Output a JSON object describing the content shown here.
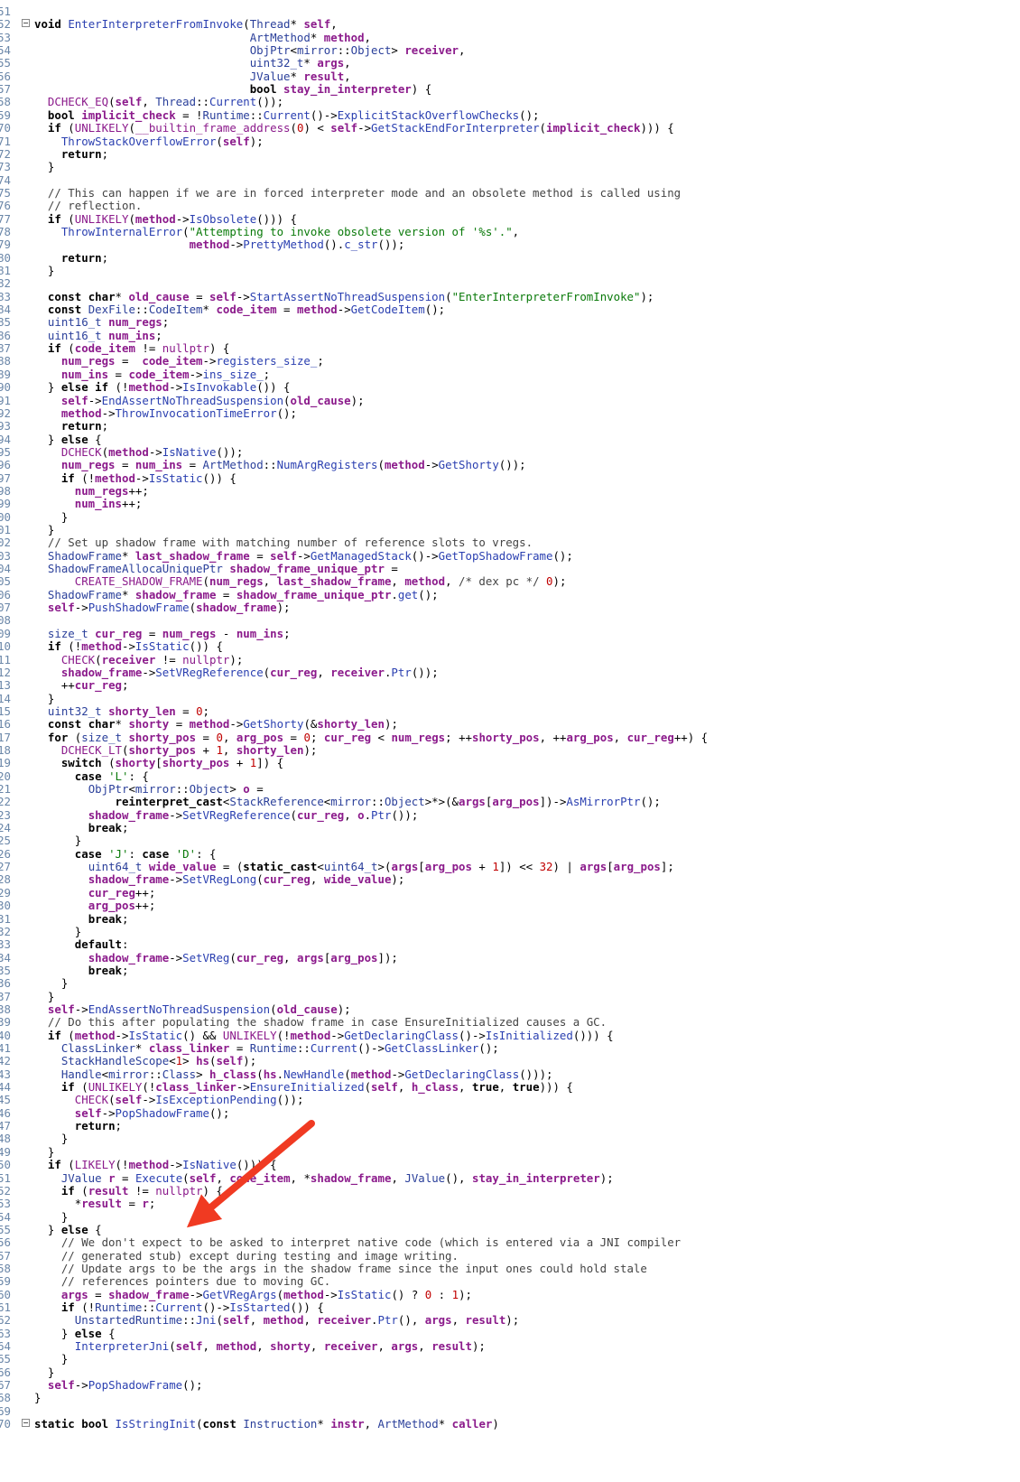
{
  "editor": {
    "lines": [
      {
        "n": "51",
        "t": ""
      },
      {
        "n": "52",
        "t": "void EnterInterpreterFromInvoke(Thread* self,",
        "fold": true
      },
      {
        "n": "53",
        "t": "                                ArtMethod* method,"
      },
      {
        "n": "54",
        "t": "                                ObjPtr<mirror::Object> receiver,"
      },
      {
        "n": "55",
        "t": "                                uint32_t* args,"
      },
      {
        "n": "56",
        "t": "                                JValue* result,"
      },
      {
        "n": "57",
        "t": "                                bool stay_in_interpreter) {"
      },
      {
        "n": "58",
        "t": "  DCHECK_EQ(self, Thread::Current());"
      },
      {
        "n": "59",
        "t": "  bool implicit_check = !Runtime::Current()->ExplicitStackOverflowChecks();"
      },
      {
        "n": "70",
        "t": "  if (UNLIKELY(__builtin_frame_address(0) < self->GetStackEndForInterpreter(implicit_check))) {"
      },
      {
        "n": "71",
        "t": "    ThrowStackOverflowError(self);"
      },
      {
        "n": "72",
        "t": "    return;"
      },
      {
        "n": "73",
        "t": "  }"
      },
      {
        "n": "74",
        "t": ""
      },
      {
        "n": "75",
        "t": "  // This can happen if we are in forced interpreter mode and an obsolete method is called using"
      },
      {
        "n": "76",
        "t": "  // reflection."
      },
      {
        "n": "77",
        "t": "  if (UNLIKELY(method->IsObsolete())) {"
      },
      {
        "n": "78",
        "t": "    ThrowInternalError(\"Attempting to invoke obsolete version of '%s'.\","
      },
      {
        "n": "79",
        "t": "                       method->PrettyMethod().c_str());"
      },
      {
        "n": "80",
        "t": "    return;"
      },
      {
        "n": "81",
        "t": "  }"
      },
      {
        "n": "82",
        "t": ""
      },
      {
        "n": "83",
        "t": "  const char* old_cause = self->StartAssertNoThreadSuspension(\"EnterInterpreterFromInvoke\");"
      },
      {
        "n": "84",
        "t": "  const DexFile::CodeItem* code_item = method->GetCodeItem();"
      },
      {
        "n": "85",
        "t": "  uint16_t num_regs;"
      },
      {
        "n": "86",
        "t": "  uint16_t num_ins;"
      },
      {
        "n": "87",
        "t": "  if (code_item != nullptr) {"
      },
      {
        "n": "88",
        "t": "    num_regs =  code_item->registers_size_;"
      },
      {
        "n": "89",
        "t": "    num_ins = code_item->ins_size_;"
      },
      {
        "n": "90",
        "t": "  } else if (!method->IsInvokable()) {"
      },
      {
        "n": "91",
        "t": "    self->EndAssertNoThreadSuspension(old_cause);"
      },
      {
        "n": "92",
        "t": "    method->ThrowInvocationTimeError();"
      },
      {
        "n": "93",
        "t": "    return;"
      },
      {
        "n": "94",
        "t": "  } else {"
      },
      {
        "n": "95",
        "t": "    DCHECK(method->IsNative());"
      },
      {
        "n": "96",
        "t": "    num_regs = num_ins = ArtMethod::NumArgRegisters(method->GetShorty());"
      },
      {
        "n": "97",
        "t": "    if (!method->IsStatic()) {"
      },
      {
        "n": "98",
        "t": "      num_regs++;"
      },
      {
        "n": "99",
        "t": "      num_ins++;"
      },
      {
        "n": "00",
        "t": "    }"
      },
      {
        "n": "01",
        "t": "  }"
      },
      {
        "n": "02",
        "t": "  // Set up shadow frame with matching number of reference slots to vregs."
      },
      {
        "n": "03",
        "t": "  ShadowFrame* last_shadow_frame = self->GetManagedStack()->GetTopShadowFrame();"
      },
      {
        "n": "04",
        "t": "  ShadowFrameAllocaUniquePtr shadow_frame_unique_ptr ="
      },
      {
        "n": "05",
        "t": "      CREATE_SHADOW_FRAME(num_regs, last_shadow_frame, method, /* dex pc */ 0);"
      },
      {
        "n": "06",
        "t": "  ShadowFrame* shadow_frame = shadow_frame_unique_ptr.get();"
      },
      {
        "n": "07",
        "t": "  self->PushShadowFrame(shadow_frame);"
      },
      {
        "n": "08",
        "t": ""
      },
      {
        "n": "09",
        "t": "  size_t cur_reg = num_regs - num_ins;"
      },
      {
        "n": "10",
        "t": "  if (!method->IsStatic()) {"
      },
      {
        "n": "11",
        "t": "    CHECK(receiver != nullptr);"
      },
      {
        "n": "12",
        "t": "    shadow_frame->SetVRegReference(cur_reg, receiver.Ptr());"
      },
      {
        "n": "13",
        "t": "    ++cur_reg;"
      },
      {
        "n": "14",
        "t": "  }"
      },
      {
        "n": "15",
        "t": "  uint32_t shorty_len = 0;"
      },
      {
        "n": "16",
        "t": "  const char* shorty = method->GetShorty(&shorty_len);"
      },
      {
        "n": "17",
        "t": "  for (size_t shorty_pos = 0, arg_pos = 0; cur_reg < num_regs; ++shorty_pos, ++arg_pos, cur_reg++) {"
      },
      {
        "n": "18",
        "t": "    DCHECK_LT(shorty_pos + 1, shorty_len);"
      },
      {
        "n": "19",
        "t": "    switch (shorty[shorty_pos + 1]) {"
      },
      {
        "n": "20",
        "t": "      case 'L': {"
      },
      {
        "n": "21",
        "t": "        ObjPtr<mirror::Object> o ="
      },
      {
        "n": "22",
        "t": "            reinterpret_cast<StackReference<mirror::Object>*>(&args[arg_pos])->AsMirrorPtr();"
      },
      {
        "n": "23",
        "t": "        shadow_frame->SetVRegReference(cur_reg, o.Ptr());"
      },
      {
        "n": "24",
        "t": "        break;"
      },
      {
        "n": "25",
        "t": "      }"
      },
      {
        "n": "26",
        "t": "      case 'J': case 'D': {"
      },
      {
        "n": "27",
        "t": "        uint64_t wide_value = (static_cast<uint64_t>(args[arg_pos + 1]) << 32) | args[arg_pos];"
      },
      {
        "n": "28",
        "t": "        shadow_frame->SetVRegLong(cur_reg, wide_value);"
      },
      {
        "n": "29",
        "t": "        cur_reg++;"
      },
      {
        "n": "30",
        "t": "        arg_pos++;"
      },
      {
        "n": "31",
        "t": "        break;"
      },
      {
        "n": "32",
        "t": "      }"
      },
      {
        "n": "33",
        "t": "      default:"
      },
      {
        "n": "34",
        "t": "        shadow_frame->SetVReg(cur_reg, args[arg_pos]);"
      },
      {
        "n": "35",
        "t": "        break;"
      },
      {
        "n": "36",
        "t": "    }"
      },
      {
        "n": "37",
        "t": "  }"
      },
      {
        "n": "38",
        "t": "  self->EndAssertNoThreadSuspension(old_cause);"
      },
      {
        "n": "39",
        "t": "  // Do this after populating the shadow frame in case EnsureInitialized causes a GC."
      },
      {
        "n": "40",
        "t": "  if (method->IsStatic() && UNLIKELY(!method->GetDeclaringClass()->IsInitialized())) {"
      },
      {
        "n": "41",
        "t": "    ClassLinker* class_linker = Runtime::Current()->GetClassLinker();"
      },
      {
        "n": "42",
        "t": "    StackHandleScope<1> hs(self);"
      },
      {
        "n": "43",
        "t": "    Handle<mirror::Class> h_class(hs.NewHandle(method->GetDeclaringClass()));"
      },
      {
        "n": "44",
        "t": "    if (UNLIKELY(!class_linker->EnsureInitialized(self, h_class, true, true))) {"
      },
      {
        "n": "45",
        "t": "      CHECK(self->IsExceptionPending());"
      },
      {
        "n": "46",
        "t": "      self->PopShadowFrame();"
      },
      {
        "n": "47",
        "t": "      return;"
      },
      {
        "n": "48",
        "t": "    }"
      },
      {
        "n": "49",
        "t": "  }"
      },
      {
        "n": "50",
        "t": "  if (LIKELY(!method->IsNative())) {"
      },
      {
        "n": "51",
        "t": "    JValue r = Execute(self, code_item, *shadow_frame, JValue(), stay_in_interpreter);"
      },
      {
        "n": "52",
        "t": "    if (result != nullptr) {"
      },
      {
        "n": "53",
        "t": "      *result = r;"
      },
      {
        "n": "54",
        "t": "    }"
      },
      {
        "n": "55",
        "t": "  } else {"
      },
      {
        "n": "56",
        "t": "    // We don't expect to be asked to interpret native code (which is entered via a JNI compiler"
      },
      {
        "n": "57",
        "t": "    // generated stub) except during testing and image writing."
      },
      {
        "n": "58",
        "t": "    // Update args to be the args in the shadow frame since the input ones could hold stale"
      },
      {
        "n": "59",
        "t": "    // references pointers due to moving GC."
      },
      {
        "n": "60",
        "t": "    args = shadow_frame->GetVRegArgs(method->IsStatic() ? 0 : 1);"
      },
      {
        "n": "61",
        "t": "    if (!Runtime::Current()->IsStarted()) {"
      },
      {
        "n": "62",
        "t": "      UnstartedRuntime::Jni(self, method, receiver.Ptr(), args, result);"
      },
      {
        "n": "63",
        "t": "    } else {"
      },
      {
        "n": "64",
        "t": "      InterpreterJni(self, method, shorty, receiver, args, result);"
      },
      {
        "n": "65",
        "t": "    }"
      },
      {
        "n": "66",
        "t": "  }"
      },
      {
        "n": "67",
        "t": "  self->PopShadowFrame();"
      },
      {
        "n": "68",
        "t": "}"
      },
      {
        "n": "69",
        "t": ""
      },
      {
        "n": "70",
        "t": "static bool IsStringInit(const Instruction* instr, ArtMethod* caller)",
        "fold": true
      }
    ]
  },
  "annotation": {
    "arrow_color": "#f03a22"
  }
}
